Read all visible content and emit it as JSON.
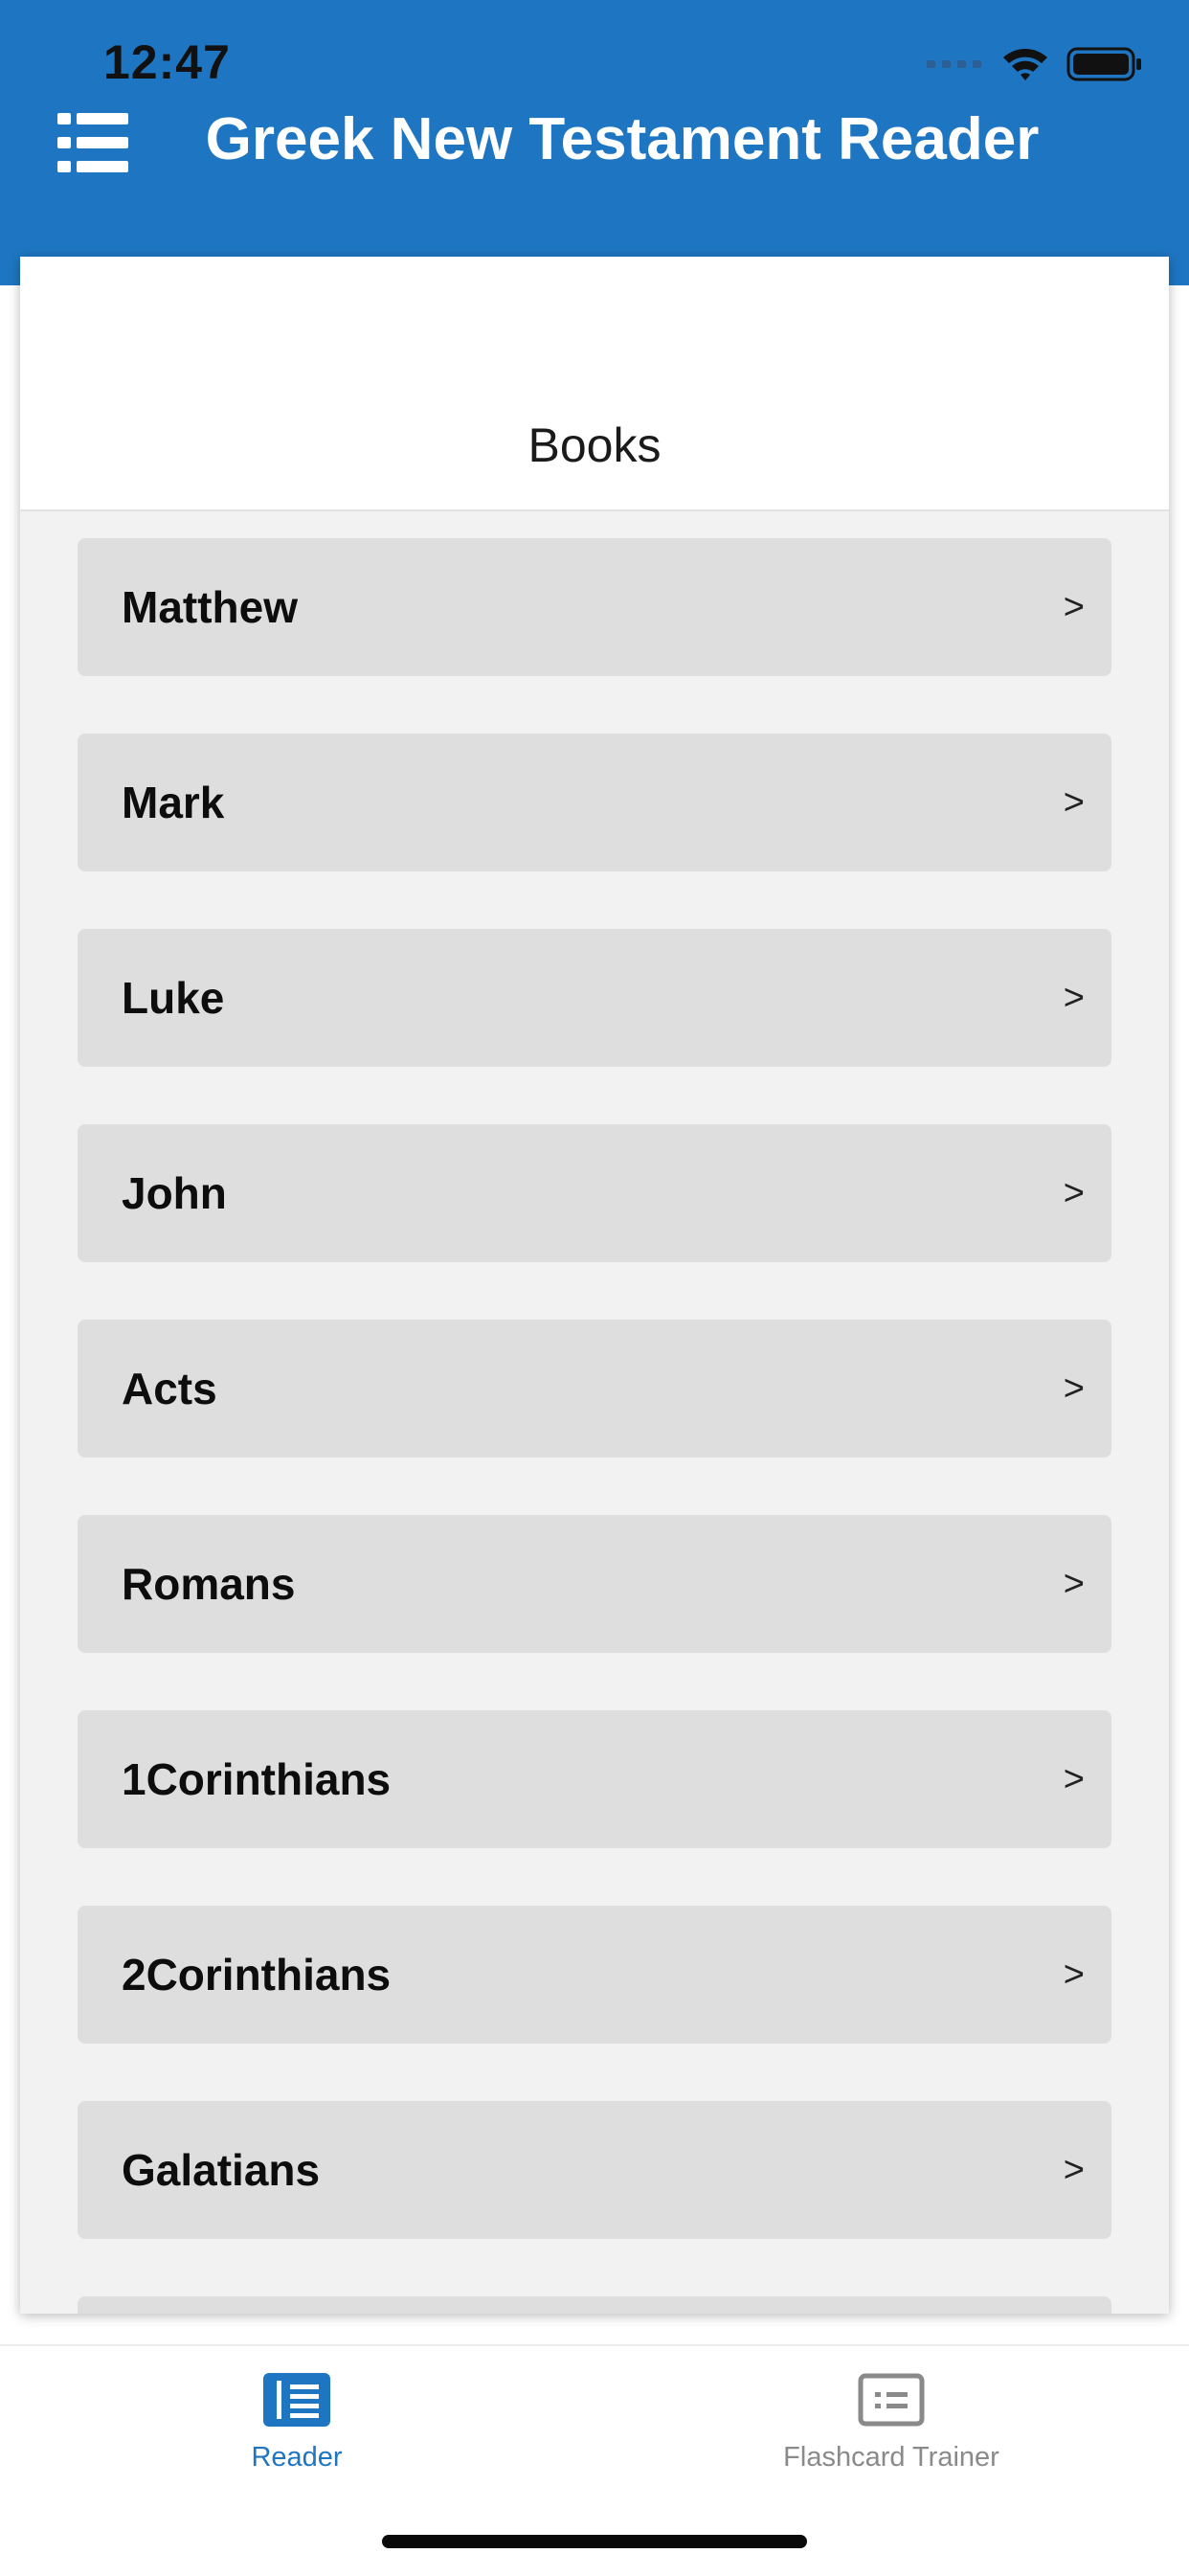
{
  "status_bar": {
    "time": "12:47"
  },
  "header": {
    "title": "Greek New Testament Reader",
    "background_color": "#1e76c2",
    "menu_icon": "hamburger-list-icon"
  },
  "card": {
    "title": "Books"
  },
  "books": [
    {
      "label": "Matthew",
      "chevron": ">"
    },
    {
      "label": "Mark",
      "chevron": ">"
    },
    {
      "label": "Luke",
      "chevron": ">"
    },
    {
      "label": "John",
      "chevron": ">"
    },
    {
      "label": "Acts",
      "chevron": ">"
    },
    {
      "label": "Romans",
      "chevron": ">"
    },
    {
      "label": "1Corinthians",
      "chevron": ">"
    },
    {
      "label": "2Corinthians",
      "chevron": ">"
    },
    {
      "label": "Galatians",
      "chevron": ">"
    },
    {
      "label": "",
      "chevron": ""
    }
  ],
  "tab_bar": {
    "tabs": [
      {
        "label": "Reader",
        "icon": "book-reader-icon",
        "active": true,
        "color": "#1e76c2"
      },
      {
        "label": "Flashcard Trainer",
        "icon": "flashcard-icon",
        "active": false,
        "color": "#8a8a8a"
      }
    ]
  }
}
